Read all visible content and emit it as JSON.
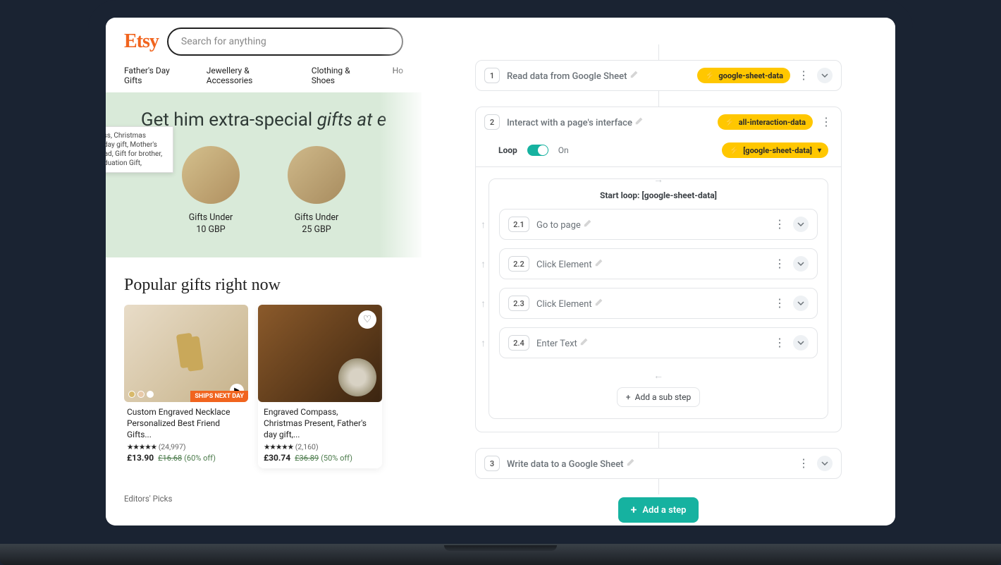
{
  "left": {
    "logo": "Etsy",
    "search_placeholder": "Search for anything",
    "nav": [
      "Father's Day Gifts",
      "Jewellery & Accessories",
      "Clothing & Shoes",
      "Ho"
    ],
    "banner_prefix": "Get him extra-special ",
    "banner_em": "gifts at e",
    "tooltip": "Engraved Compass, Christmas Present, Father's day gift, Mother's day gift,  Gift for dad, Gift for brother, Baptized gift,  Graduation Gift,",
    "gifts": [
      {
        "line1": "Gifts Under",
        "line2": "10 GBP"
      },
      {
        "line1": "Gifts Under",
        "line2": "25 GBP"
      }
    ],
    "popular_heading": "Popular gifts right now",
    "products": [
      {
        "title": "Custom Engraved Necklace Personalized Best Friend Gifts...",
        "count": "(24,997)",
        "price": "£13.90",
        "orig": "£16.68",
        "off": "(60% off)",
        "ships_badge": "SHIPS NEXT DAY"
      },
      {
        "title": "Engraved Compass, Christmas Present, Father's day gift,...",
        "count": "(2,160)",
        "price": "£30.74",
        "orig": "£36.89",
        "off": "(50% off)"
      }
    ],
    "editors_label": "Editors' Picks"
  },
  "right": {
    "steps": [
      {
        "num": "1",
        "title": "Read data from Google Sheet",
        "pill": "google-sheet-data"
      },
      {
        "num": "2",
        "title": "Interact with a page's interface",
        "pill": "all-interaction-data"
      },
      {
        "num": "3",
        "title": "Write data to a Google Sheet"
      }
    ],
    "loop": {
      "label": "Loop",
      "state": "On",
      "pill": "[google-sheet-data]",
      "start_label": "Start loop: [google-sheet-data]",
      "substeps": [
        {
          "num": "2.1",
          "title": "Go to page"
        },
        {
          "num": "2.2",
          "title": "Click Element"
        },
        {
          "num": "2.3",
          "title": "Click Element"
        },
        {
          "num": "2.4",
          "title": "Enter Text"
        }
      ],
      "add_sub": "Add a sub step"
    },
    "add_step": "Add a step"
  }
}
